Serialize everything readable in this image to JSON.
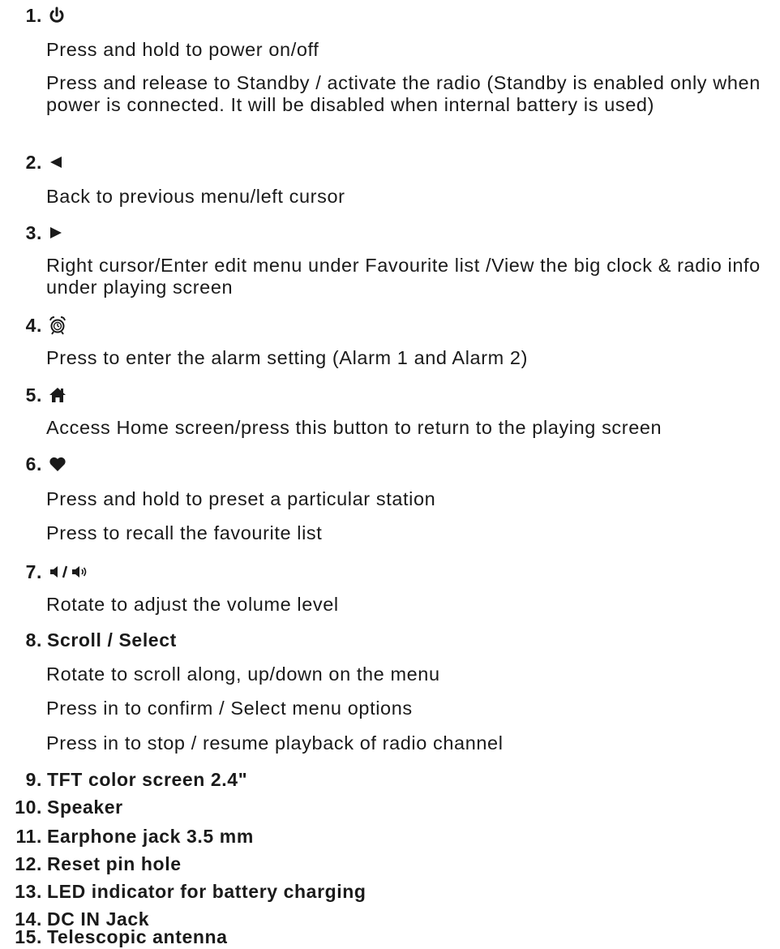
{
  "items": [
    {
      "number": "1.",
      "icon": "power-icon",
      "title": "",
      "lines": [
        "Press and hold to power on/off",
        "Press and release to Standby / activate the radio (Standby is enabled only when power is connected. It will be disabled when internal battery is used)"
      ]
    },
    {
      "number": "2.",
      "icon": "left-triangle-icon",
      "title": "",
      "lines": [
        "Back to previous menu/left cursor"
      ]
    },
    {
      "number": "3.",
      "icon": "right-triangle-icon",
      "title": "",
      "lines": [
        "Right cursor/Enter edit menu under Favourite list /View the big clock & radio info under playing screen"
      ]
    },
    {
      "number": "4.",
      "icon": "alarm-clock-icon",
      "title": "",
      "lines": [
        "Press to enter the alarm setting (Alarm 1 and Alarm 2)"
      ]
    },
    {
      "number": "5.",
      "icon": "home-icon",
      "title": "",
      "lines": [
        "Access Home screen/press this button to return to the playing screen"
      ]
    },
    {
      "number": "6.",
      "icon": "heart-icon",
      "title": "",
      "lines": [
        "Press and hold to preset a particular station",
        "Press to recall the favourite list"
      ]
    },
    {
      "number": "7.",
      "icon": "volume-down-up-icon",
      "title": "",
      "lines": [
        "Rotate to adjust the volume level"
      ]
    },
    {
      "number": "8.",
      "icon": "",
      "title": "Scroll / Select",
      "lines": [
        "Rotate to scroll along, up/down on the menu",
        "Press in to confirm / Select menu options",
        "Press in to stop / resume playback of radio channel"
      ]
    },
    {
      "number": "9.",
      "icon": "",
      "title": "TFT color screen 2.4\"",
      "lines": []
    },
    {
      "number": "10.",
      "icon": "",
      "title": "Speaker",
      "lines": []
    },
    {
      "number": "11.",
      "icon": "",
      "title": "Earphone jack 3.5 mm",
      "lines": []
    },
    {
      "number": "12.",
      "icon": "",
      "title": "Reset pin hole",
      "lines": []
    },
    {
      "number": "13.",
      "icon": "",
      "title": "LED indicator for battery charging",
      "lines": []
    },
    {
      "number": "14.",
      "icon": "",
      "title": "DC IN Jack",
      "lines": []
    },
    {
      "number": "15.",
      "icon": "",
      "title": "Telescopic antenna",
      "lines": []
    }
  ]
}
